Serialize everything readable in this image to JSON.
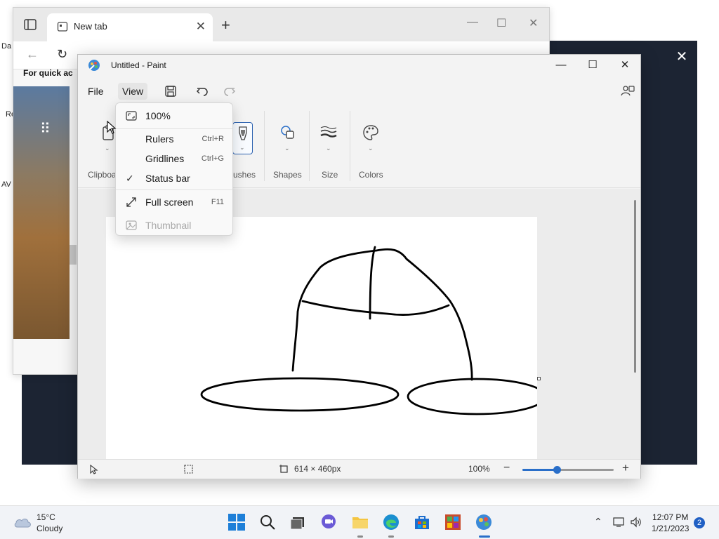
{
  "browser": {
    "tab_title": "New tab",
    "quick_access_text": "For quick ac",
    "desktop_labels": [
      "Da",
      "Re",
      "AV"
    ]
  },
  "paint": {
    "window_title": "Untitled - Paint",
    "menu": {
      "file": "File",
      "view": "View"
    },
    "ribbon_groups": {
      "clipboard": "Clipboa",
      "brushes": "ushes",
      "shapes": "Shapes",
      "size": "Size",
      "colors": "Colors"
    },
    "view_menu": {
      "zoom_100": "100%",
      "rulers": "Rulers",
      "rulers_shortcut": "Ctrl+R",
      "gridlines": "Gridlines",
      "gridlines_shortcut": "Ctrl+G",
      "status_bar": "Status bar",
      "status_bar_checked": true,
      "full_screen": "Full screen",
      "full_screen_shortcut": "F11",
      "thumbnail": "Thumbnail"
    },
    "status": {
      "canvas_size": "614 × 460px",
      "zoom": "100%",
      "zoom_slider_fraction": 0.38
    }
  },
  "taskbar": {
    "temperature": "15°C",
    "weather": "Cloudy",
    "time": "12:07 PM",
    "date": "1/21/2023",
    "notification_count": "2"
  },
  "colors": {
    "accent": "#2a6fc9",
    "desktop_dark": "#1c2433"
  }
}
